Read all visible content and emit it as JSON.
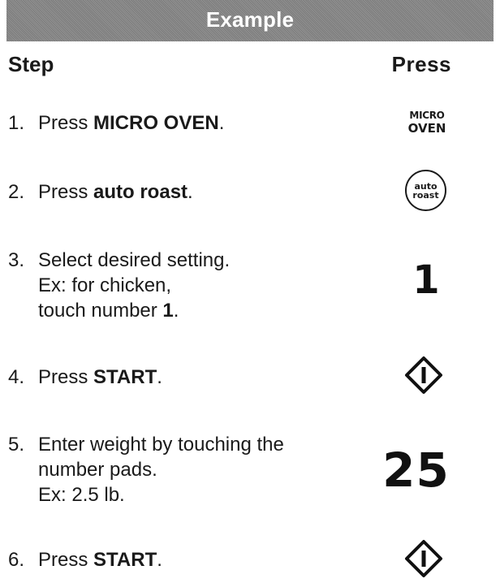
{
  "header": {
    "title": "Example"
  },
  "columns": {
    "step": "Step",
    "press": "Press"
  },
  "steps": [
    {
      "num": "1.",
      "pre": "Press ",
      "bold": "MICRO OVEN",
      "post": "."
    },
    {
      "num": "2.",
      "pre": "Press ",
      "bold": "auto roast",
      "post": "."
    },
    {
      "num": "3.",
      "line1": "Select desired setting.",
      "line2": "Ex: for chicken,",
      "line3_pre": "touch number ",
      "line3_bold": "1",
      "line3_post": "."
    },
    {
      "num": "4.",
      "pre": "Press ",
      "bold": "START",
      "post": "."
    },
    {
      "num": "5.",
      "line1": "Enter weight by touching the",
      "line2": "number pads.",
      "line3": "Ex: 2.5 lb."
    },
    {
      "num": "6.",
      "pre": "Press ",
      "bold": "START",
      "post": "."
    }
  ],
  "keys": {
    "micro_oven_line1": "MICRO",
    "micro_oven_line2": "OVEN",
    "auto_roast_line1": "auto",
    "auto_roast_line2": "roast",
    "setting_number": "1",
    "weight_digits": "25",
    "start_icon": "start-diamond-icon"
  },
  "colors": {
    "header_bg": "#8a8a8a",
    "header_text": "#ffffff",
    "text": "#1a1a1a"
  }
}
